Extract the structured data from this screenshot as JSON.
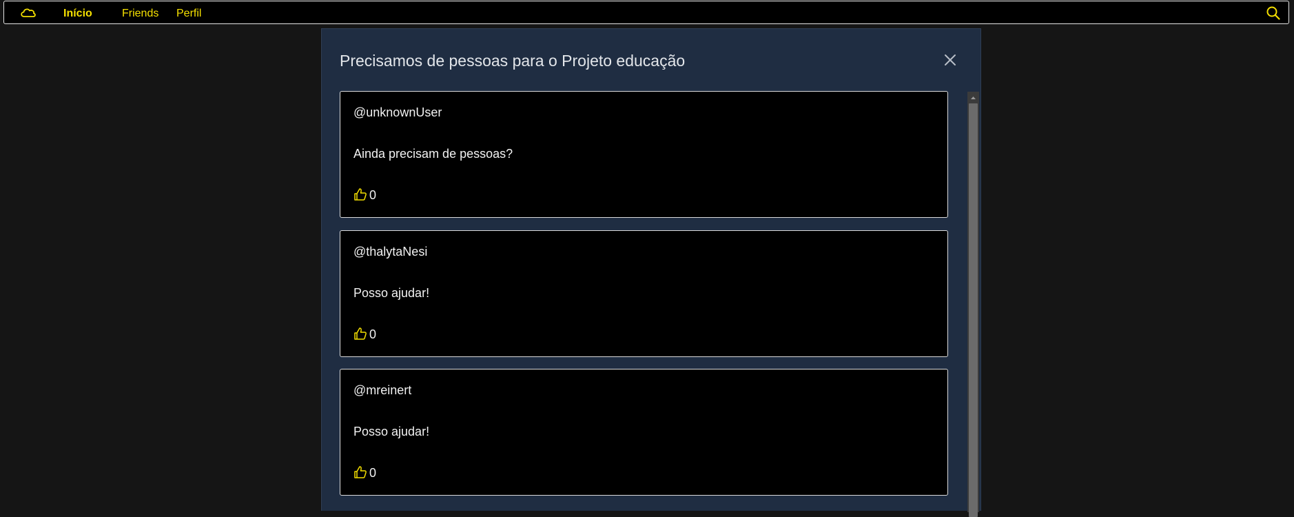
{
  "nav": {
    "logo_icon": "cloud-icon",
    "links": [
      {
        "label": "Início",
        "active": true
      },
      {
        "label": "Friends",
        "active": false
      },
      {
        "label": "Perfil",
        "active": false
      }
    ],
    "search_icon": "search-icon",
    "accent_color": "#f5e000"
  },
  "modal": {
    "title": "Precisamos de pessoas para o Projeto educação",
    "close_icon": "close-icon",
    "comments": [
      {
        "user": "@unknownUser",
        "text": "Ainda precisam de pessoas?",
        "likes": "0"
      },
      {
        "user": "@thalytaNesi",
        "text": "Posso ajudar!",
        "likes": "0"
      },
      {
        "user": "@mreinert",
        "text": "Posso ajudar!",
        "likes": "0"
      }
    ]
  },
  "colors": {
    "background": "#151515",
    "modal_bg": "#1f2d42",
    "card_bg": "#000000",
    "accent": "#f5e000"
  }
}
